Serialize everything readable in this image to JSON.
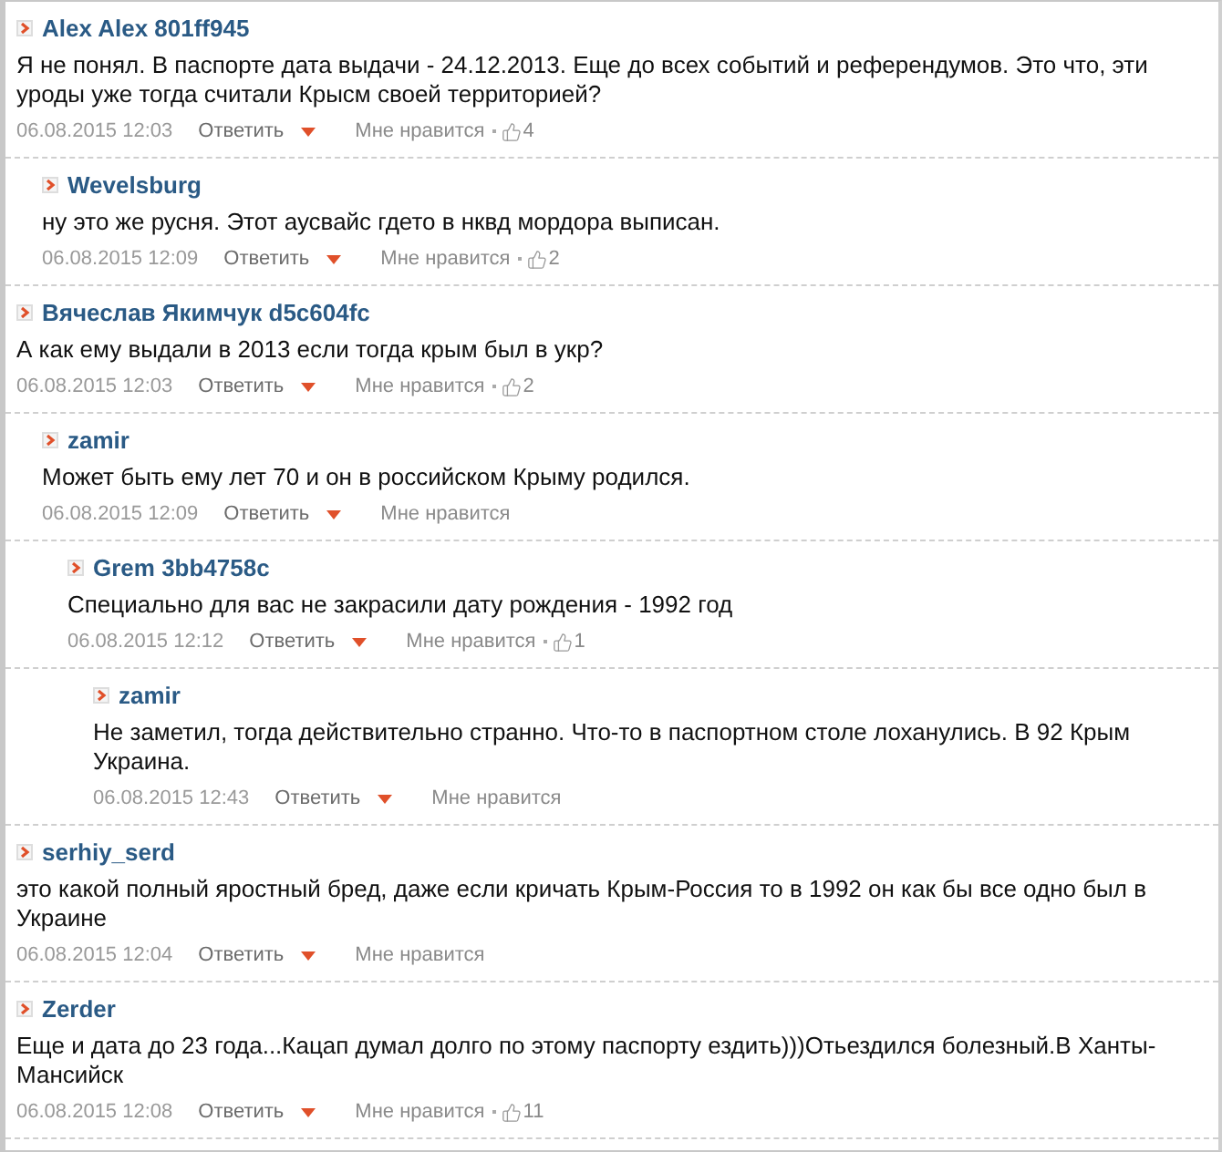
{
  "comments": [
    {
      "author": "Alex Alex 801ff945",
      "text": "Я не понял. В паспорте дата выдачи - 24.12.2013. Еще до всех событий и референдумов. Это что, эти уроды уже тогда считали Крысм своей территорией?",
      "date": "06.08.2015 12:03",
      "reply": "Ответить",
      "like": "Мне нравится",
      "likes": "4",
      "children": [
        {
          "author": "Wevelsburg",
          "text": "ну это же русня. Этот аусвайс гдето в нквд мордора выписан.",
          "date": "06.08.2015 12:09",
          "reply": "Ответить",
          "like": "Мне нравится",
          "likes": "2"
        }
      ]
    },
    {
      "author": "Вячеслав Якимчук d5c604fc",
      "text": "А как ему выдали в 2013 если тогда крым был в укр?",
      "date": "06.08.2015 12:03",
      "reply": "Ответить",
      "like": "Мне нравится",
      "likes": "2",
      "children": [
        {
          "author": "zamir",
          "text": "Может быть ему лет 70 и он в российском Крыму родился.",
          "date": "06.08.2015 12:09",
          "reply": "Ответить",
          "like": "Мне нравится",
          "children": [
            {
              "author": "Grem 3bb4758c",
              "text": "Специально для вас не закрасили дату рождения - 1992 год",
              "date": "06.08.2015 12:12",
              "reply": "Ответить",
              "like": "Мне нравится",
              "likes": "1",
              "children": [
                {
                  "author": "zamir",
                  "text": "Не заметил, тогда действительно странно. Что-то в паспортном столе лоханулись. В 92 Крым Украина.",
                  "date": "06.08.2015 12:43",
                  "reply": "Ответить",
                  "like": "Мне нравится"
                }
              ]
            }
          ]
        }
      ]
    },
    {
      "author": "serhiy_serd",
      "text": "это какой полный яростный бред, даже если кричать Крым-Россия то в 1992 он как бы все одно был в Украине",
      "date": "06.08.2015 12:04",
      "reply": "Ответить",
      "like": "Мне нравится"
    },
    {
      "author": "Zerder",
      "text": "Еще и дата до 23 года...Кацап думал долго по этому паспорту ездить)))Отьездился болезный.В Ханты-Мансийск",
      "date": "06.08.2015 12:08",
      "reply": "Ответить",
      "like": "Мне нравится",
      "likes": "11"
    }
  ]
}
